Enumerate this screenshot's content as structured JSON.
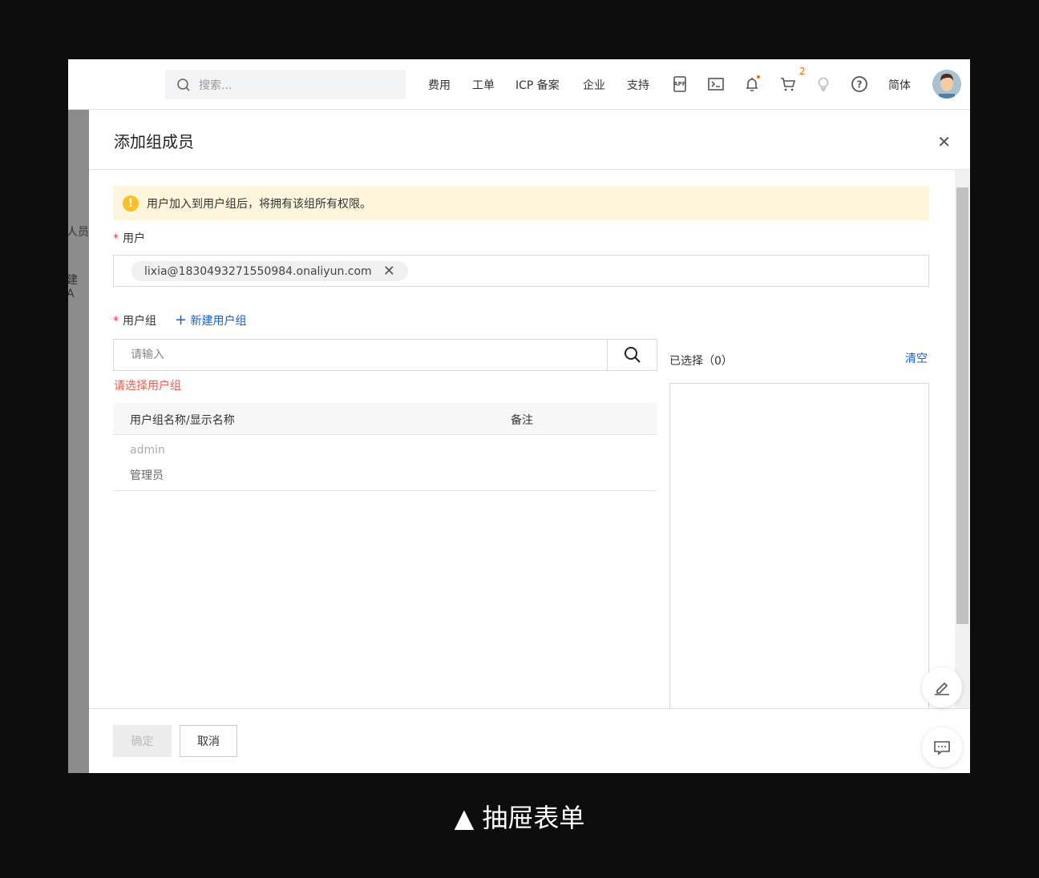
{
  "topbar": {
    "search_placeholder": "搜索...",
    "nav": [
      "费用",
      "工单",
      "ICP 备案",
      "企业",
      "支持"
    ],
    "cart_count": "2",
    "lang": "简体",
    "icons": [
      "app-icon",
      "terminal-icon",
      "bell-icon",
      "cart-icon",
      "lightbulb-icon",
      "help-icon"
    ],
    "notify_color": "#ff6a00"
  },
  "background": {
    "texts": [
      "人员",
      "建 A"
    ]
  },
  "drawer": {
    "title": "添加组成员",
    "alert": "用户加入到用户组后，将拥有该组所有权限。",
    "user_label": "用户",
    "user_tag": "lixia@1830493271550984.onaliyun.com",
    "group_label": "用户组",
    "new_group": "新建用户组",
    "group_placeholder": "请输入",
    "error": "请选择用户组",
    "table": {
      "headers": [
        "用户组名称/显示名称",
        "备注"
      ],
      "rows": [
        {
          "name": "admin",
          "display": "管理员",
          "note": ""
        }
      ]
    },
    "selected_label": "已选择（0）",
    "clear": "清空",
    "ok": "确定",
    "cancel": "取消"
  },
  "caption": "▲ 抽屉表单",
  "accent": "#1a5fcc"
}
